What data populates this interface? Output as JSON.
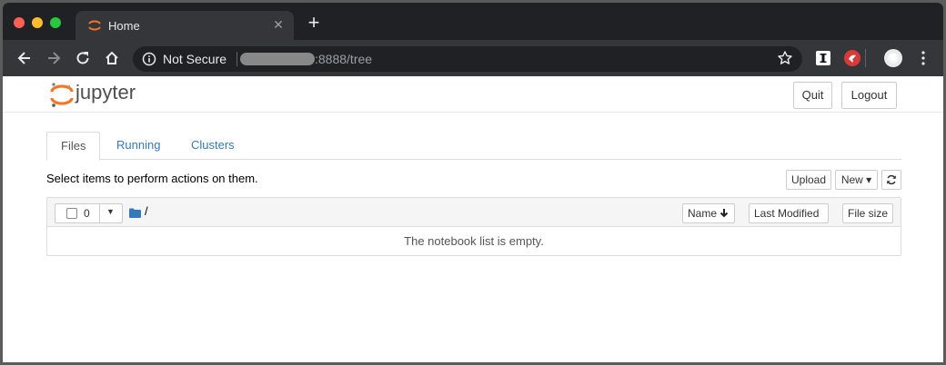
{
  "browser": {
    "tab_title": "Home",
    "tab_close": "✕",
    "new_tab": "+",
    "security_label": "Not Secure",
    "url": ":8888/tree"
  },
  "header": {
    "logo_text": "jupyter",
    "quit_label": "Quit",
    "logout_label": "Logout"
  },
  "tabs": [
    {
      "label": "Files",
      "active": true
    },
    {
      "label": "Running",
      "active": false
    },
    {
      "label": "Clusters",
      "active": false
    }
  ],
  "toolbar": {
    "message": "Select items to perform actions on them.",
    "upload_label": "Upload",
    "new_label": "New ▾"
  },
  "list": {
    "selected_count": "0",
    "breadcrumb": "/",
    "sort_name": "Name",
    "sort_modified": "Last Modified",
    "sort_size": "File size",
    "empty_message": "The notebook list is empty."
  },
  "colors": {
    "accent_link": "#337ab7",
    "jupyter_orange": "#f37726",
    "chrome_dark": "#202124"
  }
}
